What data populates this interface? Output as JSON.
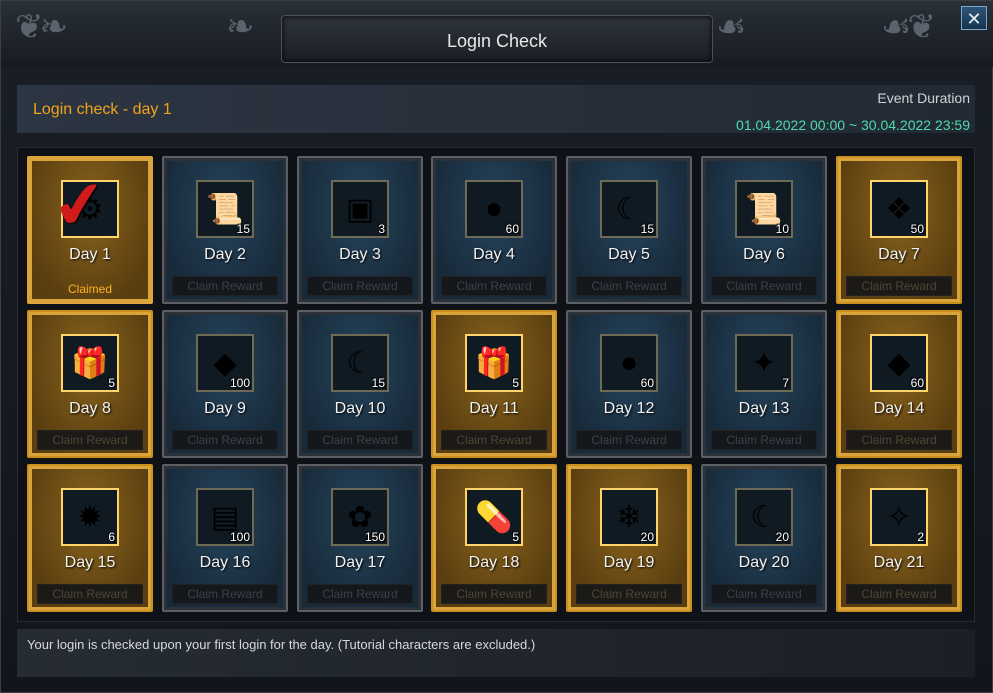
{
  "window": {
    "title": "Login Check",
    "close_icon": "close-icon",
    "close_glyph": "✕"
  },
  "info": {
    "login_day": "Login check - day 1",
    "event_label": "Event Duration",
    "event_dates": "01.04.2022 00:00 ~ 30.04.2022 23:59"
  },
  "colors": {
    "accent_orange": "#f2a31c",
    "date_green": "#4fd9b0",
    "gold_card": "#c98f1f",
    "blue_card": "#27445c"
  },
  "days": [
    {
      "label": "Day 1",
      "qty": "",
      "icon": "gear-amulet-icon",
      "glyph": "⚙",
      "gold": true,
      "status": "claimed",
      "status_text": "Claimed"
    },
    {
      "label": "Day 2",
      "qty": "15",
      "icon": "scroll-icon",
      "glyph": "📜",
      "gold": false,
      "status_text": "Claim Reward"
    },
    {
      "label": "Day 3",
      "qty": "3",
      "icon": "chest-icon",
      "glyph": "▣",
      "gold": false,
      "status_text": "Claim Reward"
    },
    {
      "label": "Day 4",
      "qty": "60",
      "icon": "gold-orb-icon",
      "glyph": "●",
      "gold": false,
      "status_text": "Claim Reward"
    },
    {
      "label": "Day 5",
      "qty": "15",
      "icon": "rune-scroll-icon",
      "glyph": "☾",
      "gold": false,
      "status_text": "Claim Reward"
    },
    {
      "label": "Day 6",
      "qty": "10",
      "icon": "scroll-icon",
      "glyph": "📜",
      "gold": false,
      "status_text": "Claim Reward"
    },
    {
      "label": "Day 7",
      "qty": "50",
      "icon": "crystal-wing-icon",
      "glyph": "❖",
      "gold": true,
      "status_text": "Claim Reward"
    },
    {
      "label": "Day 8",
      "qty": "5",
      "icon": "gift-box-icon",
      "glyph": "🎁",
      "gold": true,
      "status_text": "Claim Reward"
    },
    {
      "label": "Day 9",
      "qty": "100",
      "icon": "diamond-icon",
      "glyph": "◆",
      "gold": false,
      "status_text": "Claim Reward"
    },
    {
      "label": "Day 10",
      "qty": "15",
      "icon": "rune-scroll-icon",
      "glyph": "☾",
      "gold": false,
      "status_text": "Claim Reward"
    },
    {
      "label": "Day 11",
      "qty": "5",
      "icon": "green-gift-icon",
      "glyph": "🎁",
      "gold": true,
      "status_text": "Claim Reward"
    },
    {
      "label": "Day 12",
      "qty": "60",
      "icon": "gold-orb-icon",
      "glyph": "●",
      "gold": false,
      "status_text": "Claim Reward"
    },
    {
      "label": "Day 13",
      "qty": "7",
      "icon": "rainbow-gem-icon",
      "glyph": "✦",
      "gold": false,
      "status_text": "Claim Reward"
    },
    {
      "label": "Day 14",
      "qty": "60",
      "icon": "diamond-icon",
      "glyph": "◆",
      "gold": true,
      "status_text": "Claim Reward"
    },
    {
      "label": "Day 15",
      "qty": "6",
      "icon": "red-gem-icon",
      "glyph": "✹",
      "gold": true,
      "status_text": "Claim Reward"
    },
    {
      "label": "Day 16",
      "qty": "100",
      "icon": "blue-chest-icon",
      "glyph": "▤",
      "gold": false,
      "status_text": "Claim Reward"
    },
    {
      "label": "Day 17",
      "qty": "150",
      "icon": "pink-coral-icon",
      "glyph": "✿",
      "gold": false,
      "status_text": "Claim Reward"
    },
    {
      "label": "Day 18",
      "qty": "5",
      "icon": "potion-capsule-icon",
      "glyph": "💊",
      "gold": true,
      "status_text": "Claim Reward"
    },
    {
      "label": "Day 19",
      "qty": "20",
      "icon": "crystal-cluster-icon",
      "glyph": "❄",
      "gold": true,
      "status_text": "Claim Reward"
    },
    {
      "label": "Day 20",
      "qty": "20",
      "icon": "rune-scroll-icon",
      "glyph": "☾",
      "gold": false,
      "status_text": "Claim Reward"
    },
    {
      "label": "Day 21",
      "qty": "2",
      "icon": "spell-card-icon",
      "glyph": "✧",
      "gold": true,
      "status_text": "Claim Reward"
    }
  ],
  "footer": {
    "text": "Your login is checked upon your first login for the day. (Tutorial characters are excluded.)"
  }
}
